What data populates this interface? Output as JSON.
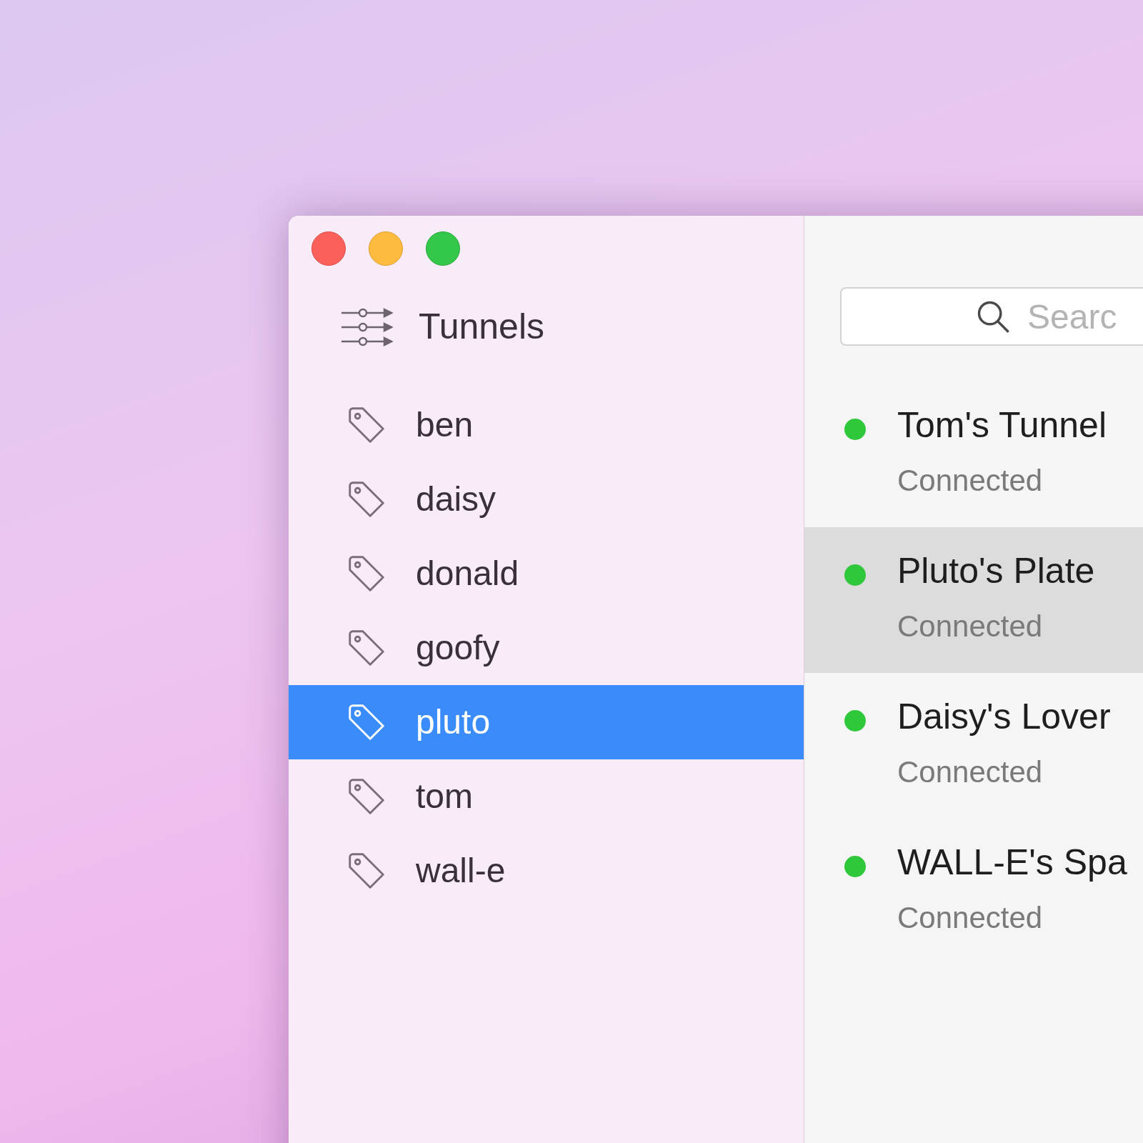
{
  "sidebar": {
    "title": "Tunnels",
    "items": [
      {
        "label": "ben",
        "selected": false
      },
      {
        "label": "daisy",
        "selected": false
      },
      {
        "label": "donald",
        "selected": false
      },
      {
        "label": "goofy",
        "selected": false
      },
      {
        "label": "pluto",
        "selected": true
      },
      {
        "label": "tom",
        "selected": false
      },
      {
        "label": "wall-e",
        "selected": false
      }
    ]
  },
  "search": {
    "placeholder": "Searc"
  },
  "tunnels": [
    {
      "name": "Tom's Tunnel",
      "status": "Connected",
      "selected": false
    },
    {
      "name": "Pluto's Plate",
      "status": "Connected",
      "selected": true
    },
    {
      "name": "Daisy's Lover",
      "status": "Connected",
      "selected": false
    },
    {
      "name": "WALL-E's Spa",
      "status": "Connected",
      "selected": false
    }
  ]
}
